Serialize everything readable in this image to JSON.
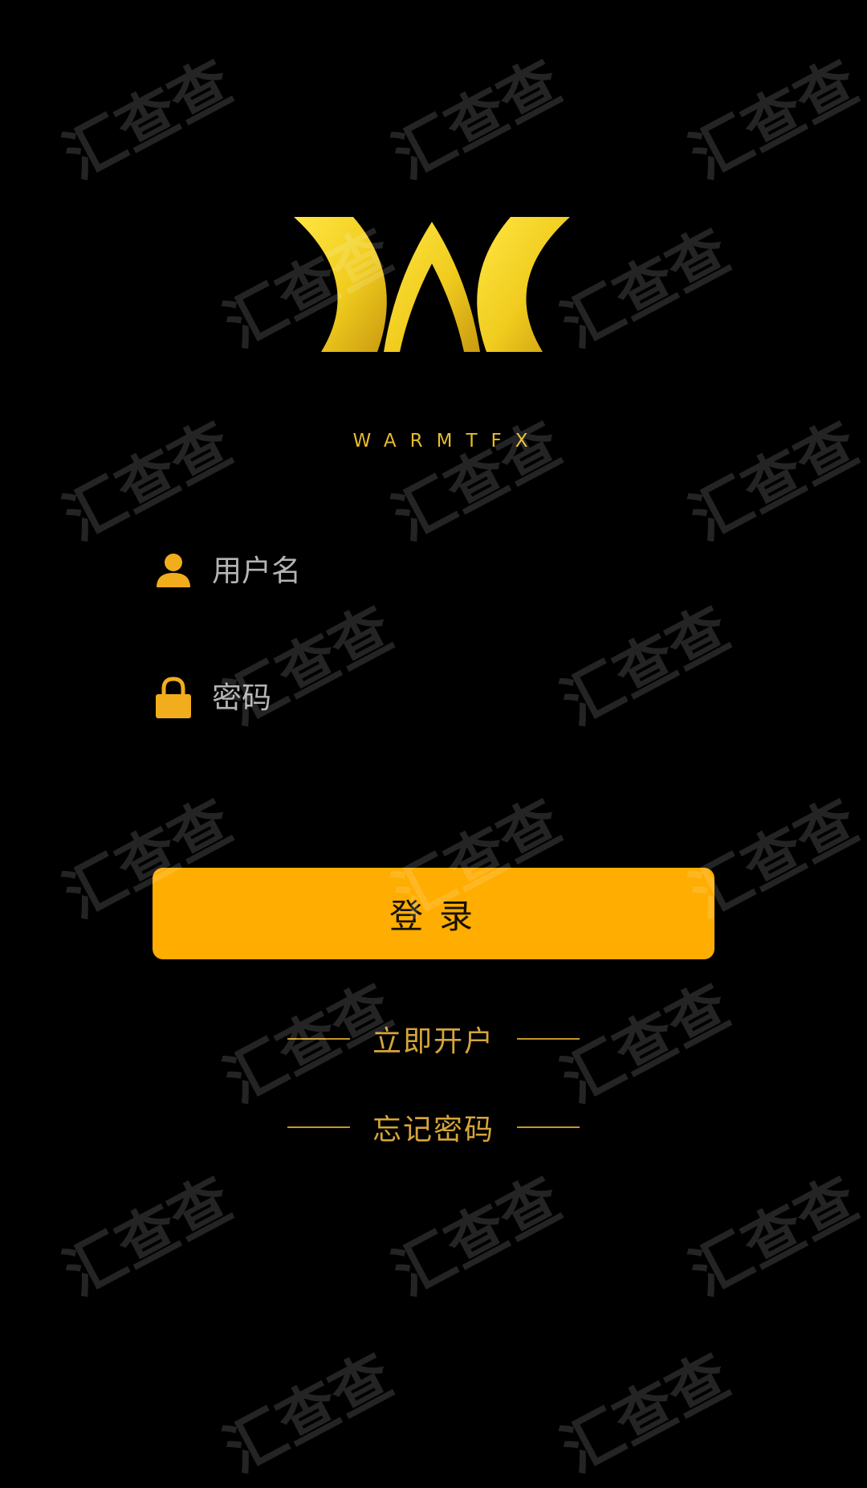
{
  "app": {
    "brand_name": "WARMTFX",
    "logo_icon": "warmtfx-w-logo",
    "colors": {
      "background": "#000000",
      "accent": "#ffad00",
      "logo_gold": "#f5d21e",
      "link_gold": "#d6a53a",
      "placeholder": "#b4b4b4"
    }
  },
  "login_form": {
    "username": {
      "icon": "user-icon",
      "placeholder": "用户名",
      "value": ""
    },
    "password": {
      "icon": "lock-icon",
      "placeholder": "密码",
      "value": ""
    },
    "submit_label": "登录"
  },
  "links": {
    "open_account": "立即开户",
    "forgot_password": "忘记密码"
  },
  "watermark": {
    "text": "汇查查"
  }
}
